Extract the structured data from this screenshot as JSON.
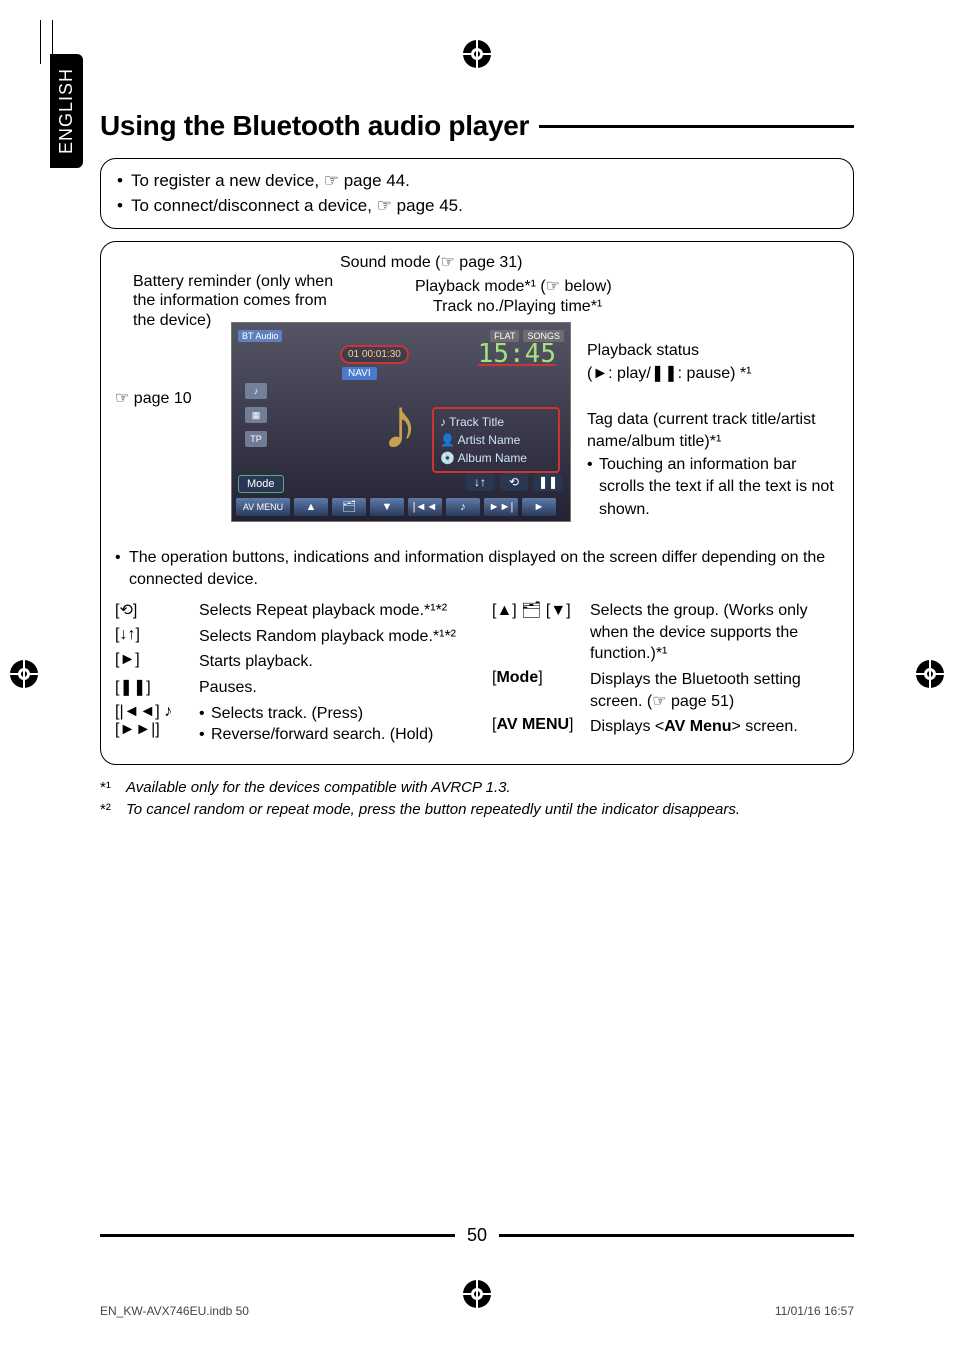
{
  "language_tab": "ENGLISH",
  "title": "Using the Bluetooth audio player",
  "intro_notes": [
    "To register a new device, ☞ page 44.",
    "To connect/disconnect a device, ☞ page 45."
  ],
  "labels": {
    "sound_mode": "Sound mode (☞ page 31)",
    "battery_reminder": "Battery reminder (only when the information comes from the device)",
    "playback_mode": "Playback mode*¹ (☞ below)",
    "track_no_time": "Track no./Playing time*¹",
    "page10_ref": "☞ page 10",
    "playback_status_title": "Playback status",
    "playback_status_detail": "(►: play/❚❚: pause) *¹",
    "tag_data": "Tag data (current track title/artist name/album title)*¹",
    "tag_data_note": "Touching an information bar scrolls the text if all the text is not shown."
  },
  "screenshot": {
    "bt_audio_chip": "BT Audio",
    "flat_chip": "FLAT",
    "songs_chip": "SONGS",
    "track_oval": "01    00:01:30",
    "navi": "NAVI",
    "big_time": "15:45",
    "meta_track": "Track Title",
    "meta_artist": "Artist Name",
    "meta_album": "Album Name",
    "tp": "TP",
    "mode": "Mode",
    "av_menu": "AV MENU"
  },
  "note_differ": "The operation buttons, indications and information displayed on the screen differ depending on the connected device.",
  "button_table_left": [
    {
      "key": "[⟲]",
      "desc": "Selects Repeat playback mode.*¹*²"
    },
    {
      "key": "[↓↑]",
      "desc": "Selects Random playback mode.*¹*²"
    },
    {
      "key": "[►]",
      "desc": "Starts playback."
    },
    {
      "key": "[❚❚]",
      "desc": "Pauses."
    },
    {
      "key": "[|◄◄] ♪\n[►►|]",
      "desc_list": [
        "Selects track. (Press)",
        "Reverse/forward search. (Hold)"
      ]
    }
  ],
  "button_table_right": [
    {
      "key": "[▲] 🗂 [▼]",
      "desc": "Selects the group. (Works only when the device supports the function.)*¹"
    },
    {
      "key": "[Mode]",
      "desc": "Displays the Bluetooth setting screen. (☞ page 51)",
      "bold_key": true
    },
    {
      "key": "[AV MENU]",
      "desc": "Displays <AV Menu> screen.",
      "bold_key": true,
      "desc_bold_span": "AV Menu"
    }
  ],
  "footnotes": [
    {
      "mark": "*¹",
      "text": "Available only for the devices compatible with AVRCP 1.3."
    },
    {
      "mark": "*²",
      "text": "To cancel random or repeat mode, press the button repeatedly until the indicator disappears."
    }
  ],
  "page_number": "50",
  "footer_left": "EN_KW-AVX746EU.indb   50",
  "footer_right": "11/01/16   16:57"
}
